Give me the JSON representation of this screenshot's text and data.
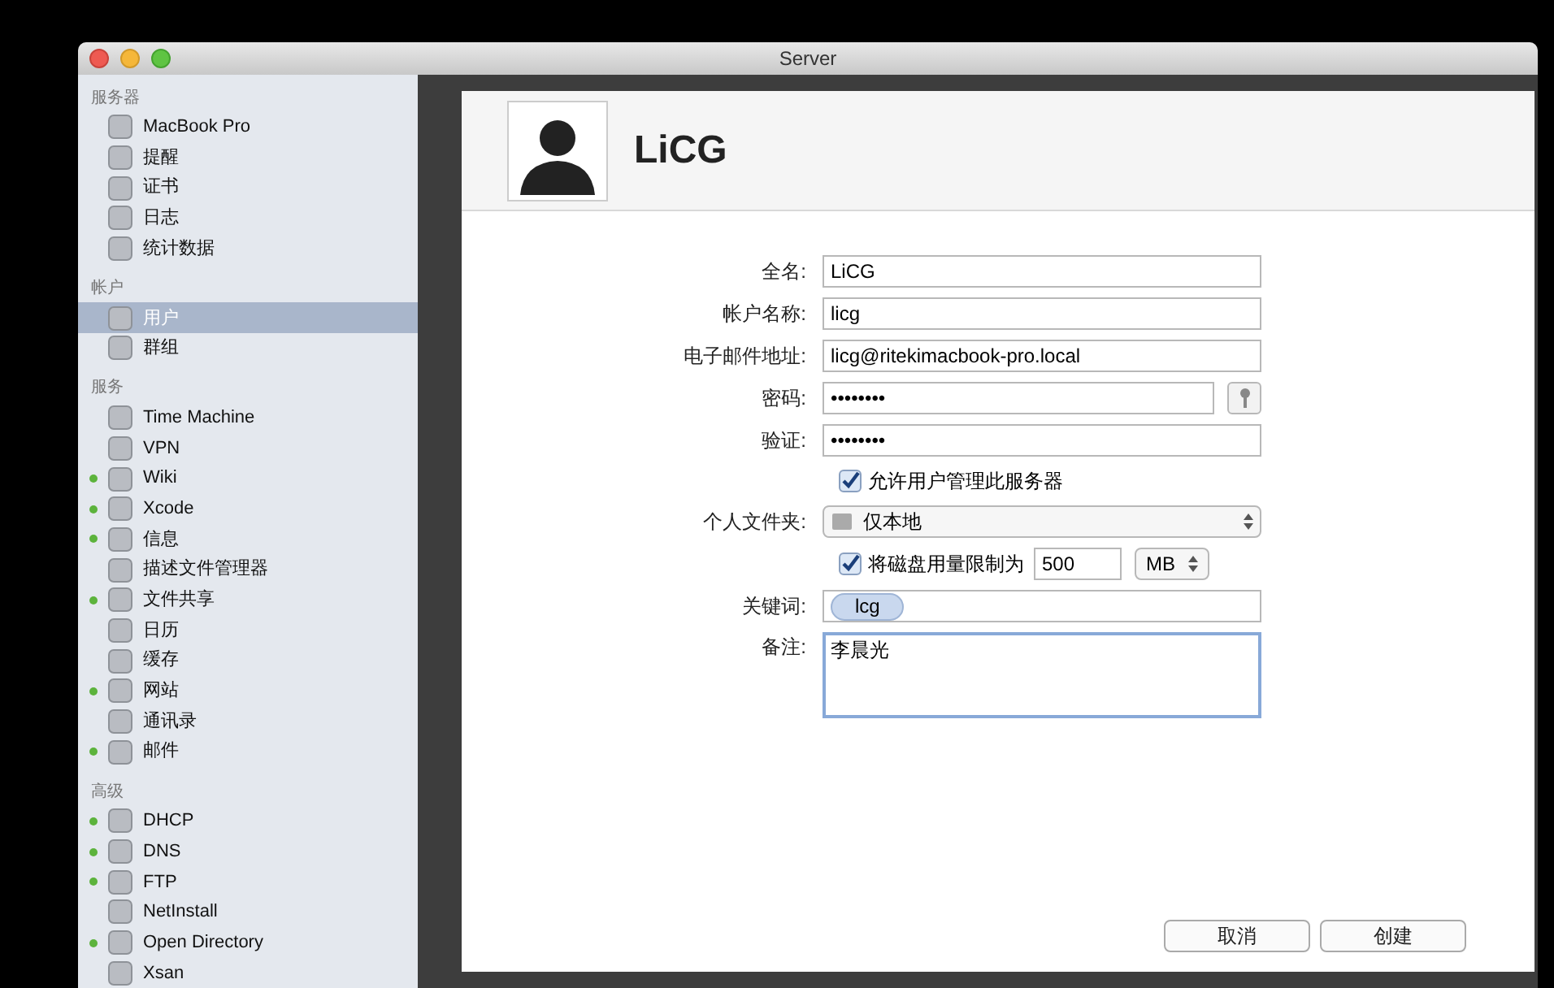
{
  "window": {
    "title": "Server"
  },
  "sidebar": {
    "sections": [
      {
        "title": "服务器",
        "items": [
          {
            "label": "MacBook Pro",
            "selected": false,
            "status_on": false
          },
          {
            "label": "提醒",
            "selected": false,
            "status_on": false
          },
          {
            "label": "证书",
            "selected": false,
            "status_on": false
          },
          {
            "label": "日志",
            "selected": false,
            "status_on": false
          },
          {
            "label": "统计数据",
            "selected": false,
            "status_on": false
          }
        ]
      },
      {
        "title": "帐户",
        "items": [
          {
            "label": "用户",
            "selected": true,
            "status_on": false
          },
          {
            "label": "群组",
            "selected": false,
            "status_on": false
          }
        ]
      },
      {
        "title": "服务",
        "items": [
          {
            "label": "Time Machine",
            "selected": false,
            "status_on": false
          },
          {
            "label": "VPN",
            "selected": false,
            "status_on": false
          },
          {
            "label": "Wiki",
            "selected": false,
            "status_on": true
          },
          {
            "label": "Xcode",
            "selected": false,
            "status_on": true
          },
          {
            "label": "信息",
            "selected": false,
            "status_on": true
          },
          {
            "label": "描述文件管理器",
            "selected": false,
            "status_on": false
          },
          {
            "label": "文件共享",
            "selected": false,
            "status_on": true
          },
          {
            "label": "日历",
            "selected": false,
            "status_on": false
          },
          {
            "label": "缓存",
            "selected": false,
            "status_on": false
          },
          {
            "label": "网站",
            "selected": false,
            "status_on": true
          },
          {
            "label": "通讯录",
            "selected": false,
            "status_on": false
          },
          {
            "label": "邮件",
            "selected": false,
            "status_on": true
          }
        ]
      },
      {
        "title": "高级",
        "items": [
          {
            "label": "DHCP",
            "selected": false,
            "status_on": true
          },
          {
            "label": "DNS",
            "selected": false,
            "status_on": true
          },
          {
            "label": "FTP",
            "selected": false,
            "status_on": true
          },
          {
            "label": "NetInstall",
            "selected": false,
            "status_on": false
          },
          {
            "label": "Open Directory",
            "selected": false,
            "status_on": true
          },
          {
            "label": "Xsan",
            "selected": false,
            "status_on": false
          }
        ]
      }
    ]
  },
  "sheet": {
    "user_name": "LiCG",
    "fields": [
      {
        "kind": "text",
        "label": "全名:",
        "value": "LiCG"
      },
      {
        "kind": "text",
        "label": "帐户名称:",
        "value": "licg"
      },
      {
        "kind": "text",
        "label": "电子邮件地址:",
        "value": "licg@ritekimacbook-pro.local"
      },
      {
        "kind": "password",
        "label": "密码:",
        "value": "••••••••"
      },
      {
        "kind": "text",
        "label": "验证:",
        "value": "••••••••"
      },
      {
        "kind": "checkbox",
        "text": "允许用户管理此服务器",
        "checked": true
      },
      {
        "kind": "select",
        "label": "个人文件夹:",
        "value": "仅本地"
      },
      {
        "kind": "quota",
        "text": "将磁盘用量限制为",
        "checked": true,
        "value": "500",
        "unit": "MB"
      },
      {
        "kind": "tokens",
        "label": "关键词:",
        "tokens": [
          "lcg"
        ]
      },
      {
        "kind": "textarea",
        "label": "备注:",
        "value": "李晨光"
      }
    ],
    "buttons": [
      "取消",
      "创建"
    ]
  }
}
